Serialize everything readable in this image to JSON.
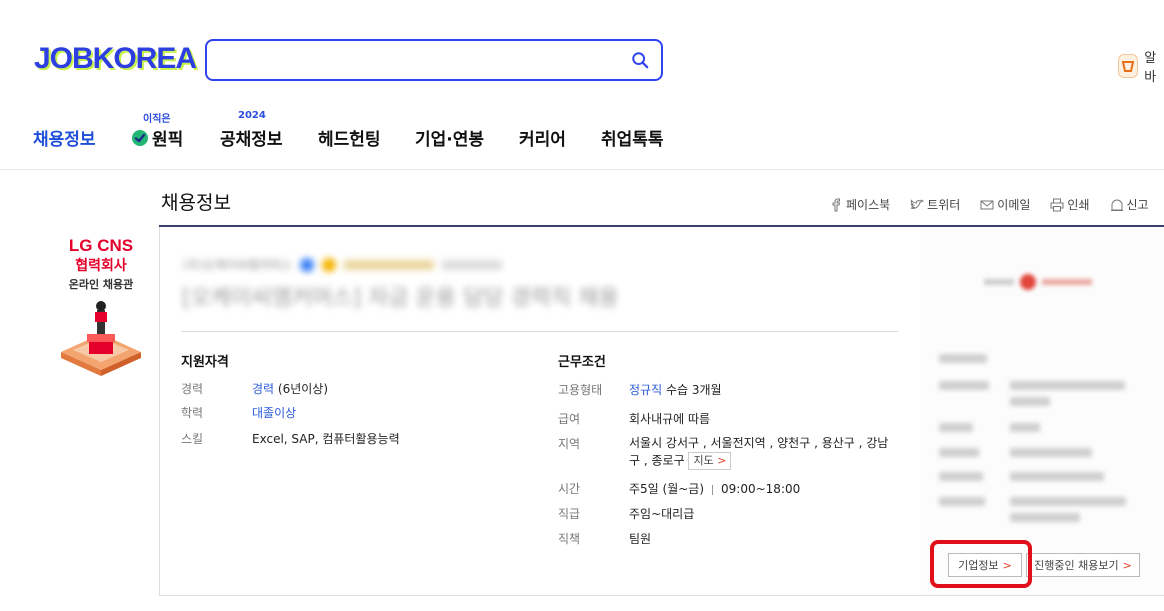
{
  "header": {
    "logo": "JOBKOREA",
    "search": {
      "value": "",
      "placeholder": ""
    },
    "alba_label": "알바"
  },
  "nav": {
    "items": [
      {
        "label": "채용정보",
        "sup": ""
      },
      {
        "label": "원픽",
        "sup": "이직은"
      },
      {
        "label": "공채정보",
        "sup": "2024"
      },
      {
        "label": "헤드헌팅",
        "sup": ""
      },
      {
        "label": "기업·연봉",
        "sup": ""
      },
      {
        "label": "커리어",
        "sup": ""
      },
      {
        "label": "취업톡톡",
        "sup": ""
      }
    ]
  },
  "banner": {
    "line1": "LG CNS",
    "line2": "협력회사",
    "line3": "온라인 채용관"
  },
  "page": {
    "title": "채용정보",
    "share": [
      "페이스북",
      "트위터",
      "이메일",
      "인쇄",
      "신고"
    ]
  },
  "job": {
    "company_blurred": "(주)오케이씨엠커머스",
    "title_blurred": "[오케이씨엠커머스] 자금 운용 담당 경력직 채용",
    "qualifications": {
      "heading": "지원자격",
      "rows": [
        {
          "label": "경력",
          "link": "경력",
          "value": " (6년이상)"
        },
        {
          "label": "학력",
          "link": "대졸이상",
          "value": ""
        },
        {
          "label": "스킬",
          "link": "",
          "value": "Excel, SAP, 컴퓨터활용능력"
        }
      ]
    },
    "conditions": {
      "heading": "근무조건",
      "employment_label": "고용형태",
      "employment_link": "정규직",
      "employment_value": " 수습 3개월",
      "salary_label": "급여",
      "salary_value": "회사내규에 따름",
      "region_label": "지역",
      "region_value_1": "서울시 강서구 , 서울전지역 , 양천구 , 용산구 , 강남",
      "region_value_2": "구 , 종로구",
      "map_button": "지도",
      "time_label": "시간",
      "time_days": "주5일 (월~금)",
      "time_hours": "09:00~18:00",
      "rank_label": "직급",
      "rank_value": "주임~대리급",
      "position_label": "직책",
      "position_value": "팀원"
    }
  },
  "side": {
    "company_info_button": "기업정보",
    "ongoing_jobs_button": "진행중인 채용보기"
  },
  "colors": {
    "brand": "#2d3fe0",
    "link": "#2a5bd7",
    "highlight": "#e00f1a"
  }
}
